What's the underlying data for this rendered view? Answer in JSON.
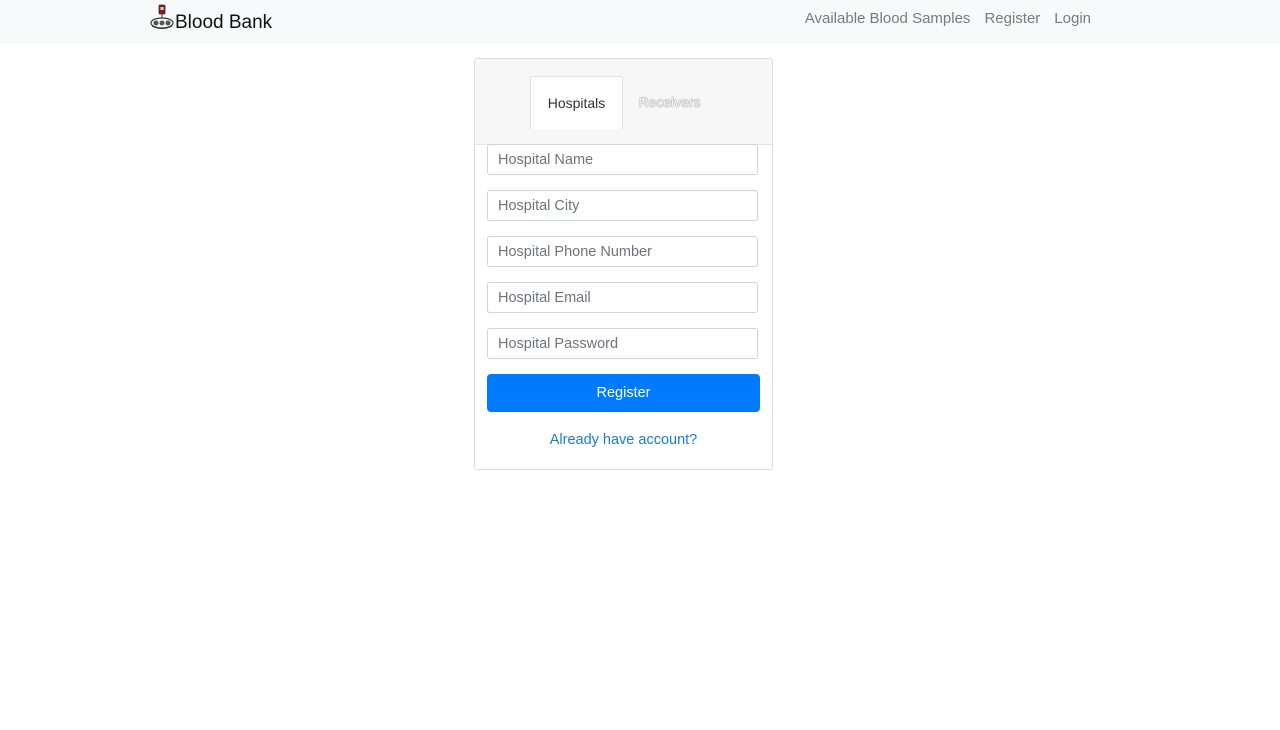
{
  "navbar": {
    "brand_name": "Blood Bank",
    "brand_icon": "blood-bank-logo-icon",
    "links": [
      {
        "label": "Available Blood Samples"
      },
      {
        "label": "Register"
      },
      {
        "label": "Login"
      }
    ]
  },
  "form": {
    "tabs": [
      {
        "label": "Hospitals",
        "active": true
      },
      {
        "label": "Receivers",
        "active": false
      }
    ],
    "fields": {
      "name_placeholder": "Hospital Name",
      "city_placeholder": "Hospital City",
      "phone_placeholder": "Hospital Phone Number",
      "email_placeholder": "Hospital Email",
      "password_placeholder": "Hospital Password"
    },
    "submit_label": "Register",
    "login_link": "Already have account?"
  },
  "colors": {
    "primary": "#007bff",
    "navbar_bg": "#f8f9fa",
    "link": "#1a7bd1"
  }
}
